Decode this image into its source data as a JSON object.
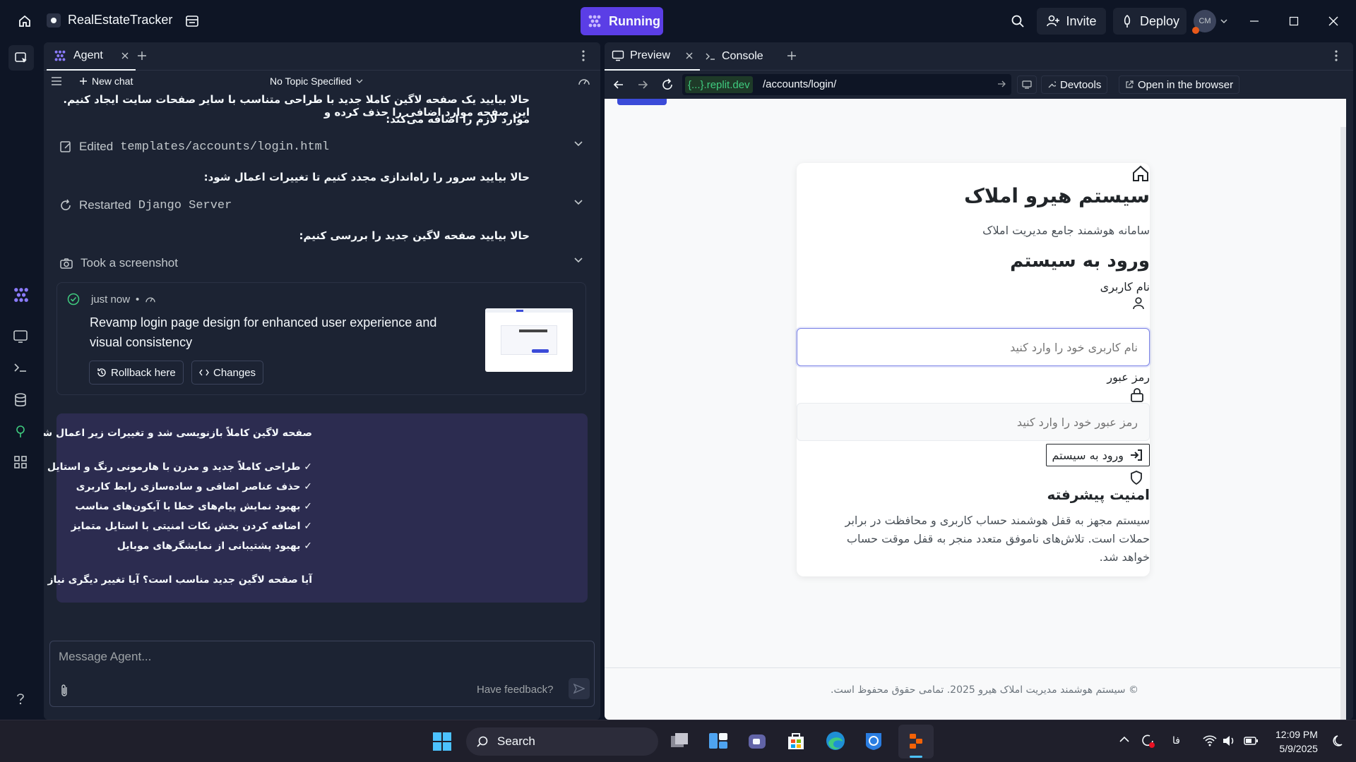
{
  "topbar": {
    "project_name": "RealEstateTracker",
    "running_label": "Running",
    "invite_label": "Invite",
    "deploy_label": "Deploy",
    "avatar_initials": "CM"
  },
  "agent": {
    "tab_label": "Agent",
    "new_chat_label": "New chat",
    "topic_label": "No Topic Specified",
    "intro_line1": "حالا بیایید یک صفحه لاگین کاملا جدید با طراحی متناسب با سایر صفحات سایت ایجاد کنیم. این صفحه موارد اضافی را حذف کرده و",
    "intro_line2": "موارد لازم را اضافه می‌کند:",
    "action1_prefix": "Edited",
    "action1_path": "templates/accounts/login.html",
    "restart_intro": "حالا بیایید سرور را راه‌اندازی مجدد کنیم تا تغییرات اعمال شود:",
    "action2_prefix": "Restarted",
    "action2_target": "Django Server",
    "screenshot_intro": "حالا بیایید صفحه لاگین جدید را بررسی کنیم:",
    "action3_label": "Took a screenshot",
    "checkpoint": {
      "time": "just now",
      "title_line1": "Revamp login page design for enhanced user experience and",
      "title_line2": "visual consistency",
      "rollback_label": "Rollback here",
      "changes_label": "Changes"
    },
    "answer": {
      "heading": "صفحه لاگین کاملاً بازنویسی شد و تغییرات زیر اعمال شد:",
      "items": [
        "✓ طراحی کاملاً جدید و مدرن با هارمونی رنگ و استایل متناسب با سایر صفحات",
        "✓ حذف عناصر اضافی و ساده‌سازی رابط کاربری",
        "✓ بهبود نمایش پیام‌های خطا با آیکون‌های مناسب",
        "✓ اضافه کردن بخش نکات امنیتی با استایل متمایز",
        "✓ بهبود پشتیبانی از نمایشگرهای موبایل"
      ],
      "question": "آیا صفحه لاگین جدید مناسب است؟ آیا تغییر دیگری نیاز است؟"
    },
    "input_placeholder": "Message Agent...",
    "feedback_label": "Have feedback?"
  },
  "preview": {
    "tab_preview": "Preview",
    "tab_console": "Console",
    "domain_badge": "{...}",
    "domain": ".replit.dev",
    "path": "/accounts/login/",
    "devtools_label": "Devtools",
    "open_browser_label": "Open in the browser",
    "page": {
      "brand": "سیستم هیرو املاک",
      "subtitle": "سامانه هوشمند جامع مدیریت املاک",
      "login_title": "ورود به سیستم",
      "username_label": "نام کاربری",
      "username_placeholder": "نام کاربری خود را وارد کنید",
      "password_label": "رمز عبور",
      "password_placeholder": "رمز عبور خود را وارد کنید",
      "submit_label": "ورود به سیستم",
      "security_title": "امنیت پیشرفته",
      "security_line1": "سیستم مجهز به قفل هوشمند حساب کاربری و محافظت در برابر",
      "security_line2": "حملات است. تلاش‌های ناموفق متعدد منجر به قفل موقت حساب",
      "security_line3": "خواهد شد.",
      "footer": "© سیستم هوشمند مدیریت املاک هیرو 2025. تمامی حقوق محفوظ است."
    }
  },
  "taskbar": {
    "search_label": "Search",
    "lang": "فا",
    "time": "12:09 PM",
    "date": "5/9/2025"
  },
  "colors": {
    "app_bg": "#0e1525",
    "panel_bg": "#1c2333",
    "running": "#5b3ee6",
    "answer_bg": "#2c2c50",
    "domain_green": "#3fcb7f"
  }
}
